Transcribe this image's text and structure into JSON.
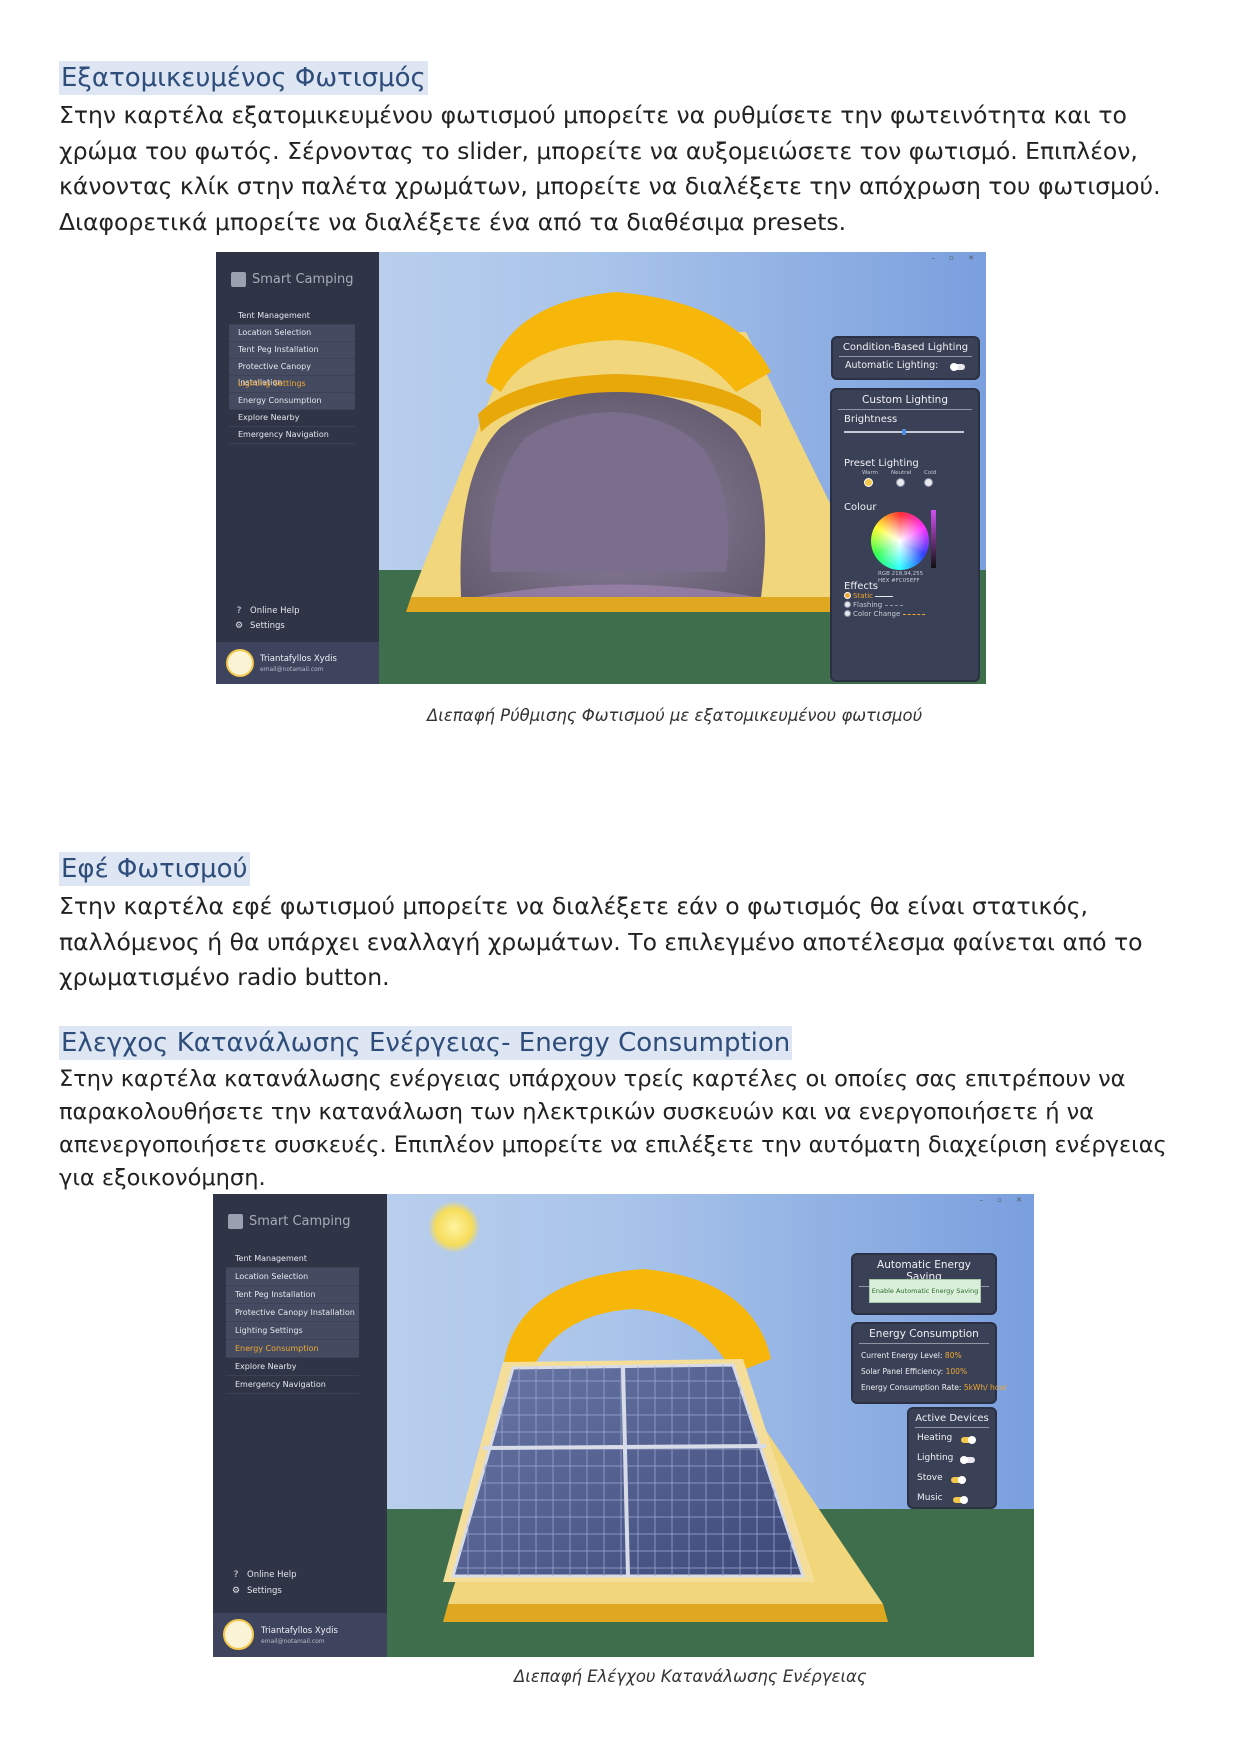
{
  "section1": {
    "heading": "Εξατομικευμένος Φωτισμός",
    "paragraph": "Στην καρτέλα εξατομικευμένου φωτισμού μπορείτε να ρυθμίσετε την φωτεινότητα και το χρώμα του φωτός. Σέρνοντας το slider, μπορείτε να αυξομειώσετε τον φωτισμό. Επιπλέον, κάνοντας κλίκ στην παλέτα χρωμάτων, μπορείτε να διαλέξετε την απόχρωση του φωτισμού. Διαφορετικά μπορείτε να διαλέξετε ένα από τα διαθέσιμα presets.",
    "caption": "Διεπαφή Ρύθμισης Φωτισμού με εξατομικευμένου φωτισμού"
  },
  "section2": {
    "heading": "Εφέ Φωτισμού",
    "paragraph": "Στην καρτέλα εφέ φωτισμού μπορείτε να διαλέξετε εάν ο φωτισμός θα είναι στατικός, παλλόμενος ή θα υπάρχει εναλλαγή χρωμάτων. Το επιλεγμένο αποτέλεσμα φαίνεται από το χρωματισμένο radio button."
  },
  "section3": {
    "heading": "Ελεγχος Κατανάλωσης Ενέργειας- Energy Consumption",
    "paragraph": "Στην καρτέλα κατανάλωσης ενέργειας υπάρχουν τρείς καρτέλες οι οποίες σας επιτρέπουν να παρακολουθήσετε την κατανάλωση των ηλεκτρικών συσκευών και να ενεργοποιήσετε ή να απενεργοποιήσετε συσκευές. Επιπλέον μπορείτε να επιλέξετε την αυτόματη διαχείριση ενέργειας για εξοικονόμηση.",
    "caption": "Διεπαφή Ελέγχου Κατανάλωσης Ενέργειας"
  },
  "app": {
    "brand": "Smart Camping",
    "window_controls": "– ▫ ✕",
    "menu": [
      "Tent Management",
      "Location Selection",
      "Tent Peg Installation",
      "Protective Canopy Installation",
      "Lighting Settings",
      "Energy Consumption",
      "Explore Nearby",
      "Emergency Navigation"
    ],
    "help": "Online Help",
    "settings": "Settings",
    "user_name": "Triantafyllos Xydis",
    "user_email": "email@notamail.com"
  },
  "lighting": {
    "condition_title": "Condition-Based Lighting",
    "auto_label": "Automatic Lighting:",
    "custom_title": "Custom Lighting",
    "brightness_label": "Brightness",
    "brightness_value": 0.5,
    "preset_label": "Preset Lighting",
    "presets": [
      "Warm",
      "Neutral",
      "Cold"
    ],
    "colour_label": "Colour",
    "rgb": "RGB 218,94,255",
    "hex": "HEX #FC05EFF",
    "effects_label": "Effects",
    "effects": [
      "Static",
      "Flashing",
      "Color Change"
    ]
  },
  "energy": {
    "auto_title": "Automatic Energy Saving",
    "auto_button": "Enable Automatic Energy Saving",
    "consumption_title": "Energy Consumption",
    "level_label": "Current Energy Level:",
    "level_value": "80%",
    "solar_label": "Solar Panel Efficiency:",
    "solar_value": "100%",
    "rate_label": "Energy Consumption Rate:",
    "rate_value": "5kWh/ hour",
    "devices_title": "Active Devices",
    "devices": [
      {
        "name": "Heating",
        "on": true
      },
      {
        "name": "Lighting",
        "on": false
      },
      {
        "name": "Stove",
        "on": true
      },
      {
        "name": "Music",
        "on": true
      }
    ]
  },
  "colors": {
    "accent": "#f0a832",
    "heading": "#2e4d7a",
    "sidebar": "#2f3446",
    "panel": "#3a4055"
  }
}
